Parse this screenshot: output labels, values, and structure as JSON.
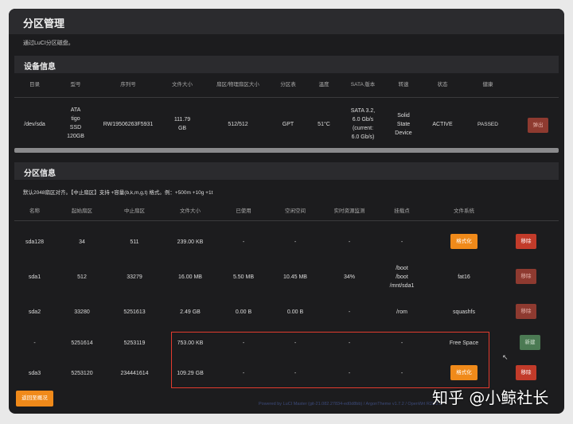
{
  "page": {
    "title": "分区管理",
    "description": "通过LuCI分区磁盘。"
  },
  "device_section": {
    "title": "设备信息",
    "headers": [
      "目录",
      "型号",
      "序列号",
      "文件大小",
      "扇区/物理扇区大小",
      "分区表",
      "温度",
      "SATA 版本",
      "转速",
      "状态",
      "健康"
    ],
    "row": {
      "path": "/dev/sda",
      "model": [
        "ATA",
        "tigo",
        "SSD",
        "120GB"
      ],
      "serial": "RW19506263F5931",
      "size": [
        "111.79",
        "GB"
      ],
      "sector": "512/512",
      "table": "GPT",
      "temp": "51°C",
      "sata": [
        "SATA 3.2,",
        "6.0 Gb/s",
        "(current:",
        "6.0 Gb/s)"
      ],
      "rotation": [
        "Solid",
        "State",
        "Device"
      ],
      "status": "ACTIVE",
      "health": "PASSED",
      "eject_label": "弹出"
    }
  },
  "partition_section": {
    "title": "分区信息",
    "hint": "默认2048扇区对齐。【中止扇区】支持 +容量(b,k,m,g,t) 格式。例：+500m +10g +1t",
    "headers": [
      "名称",
      "起始扇区",
      "中止扇区",
      "文件大小",
      "已使用",
      "空闲空间",
      "实时资源监测",
      "挂载点",
      "文件系统"
    ],
    "rows": [
      {
        "name": "sda128",
        "start": "34",
        "end": "511",
        "size": "239.00 KB",
        "used": "-",
        "free": "-",
        "usage": "-",
        "mount": [
          "-"
        ],
        "fs": "",
        "fs_button": "格式化",
        "action": "移除",
        "action_style": "red"
      },
      {
        "name": "sda1",
        "start": "512",
        "end": "33279",
        "size": "16.00 MB",
        "used": "5.50 MB",
        "free": "10.45 MB",
        "usage": "34%",
        "mount": [
          "/boot",
          "/boot",
          "/mnt/sda1"
        ],
        "fs": "fat16",
        "fs_button": "",
        "action": "移除",
        "action_style": "dim"
      },
      {
        "name": "sda2",
        "start": "33280",
        "end": "5251613",
        "size": "2.49 GB",
        "used": "0.00 B",
        "free": "0.00 B",
        "usage": "-",
        "mount": [
          "/rom"
        ],
        "fs": "squashfs",
        "fs_button": "",
        "action": "移除",
        "action_style": "dim"
      },
      {
        "name": "-",
        "start": "5251614",
        "end": "5253119",
        "size": "753.00 KB",
        "used": "-",
        "free": "-",
        "usage": "-",
        "mount": [
          "-"
        ],
        "fs": "Free Space",
        "fs_button": "",
        "action": "新建",
        "action_style": "green"
      },
      {
        "name": "sda3",
        "start": "5253120",
        "end": "234441614",
        "size": "109.29 GB",
        "used": "-",
        "free": "-",
        "usage": "-",
        "mount": [
          "-"
        ],
        "fs": "",
        "fs_button": "格式化",
        "action": "移除",
        "action_style": "red"
      }
    ]
  },
  "back_button": "返回至概况",
  "footer": "Powered by LuCI Master (git-21.082.27834-ed0d8bb) / ArgonTheme v1.7.2 / OpenWrt R23.2.2",
  "watermark": "知乎 @小鲸社长",
  "colors": {
    "accent": "#f08a1a",
    "danger": "#c23b2a",
    "success": "#4b7a53",
    "highlight": "#e23b2e"
  }
}
